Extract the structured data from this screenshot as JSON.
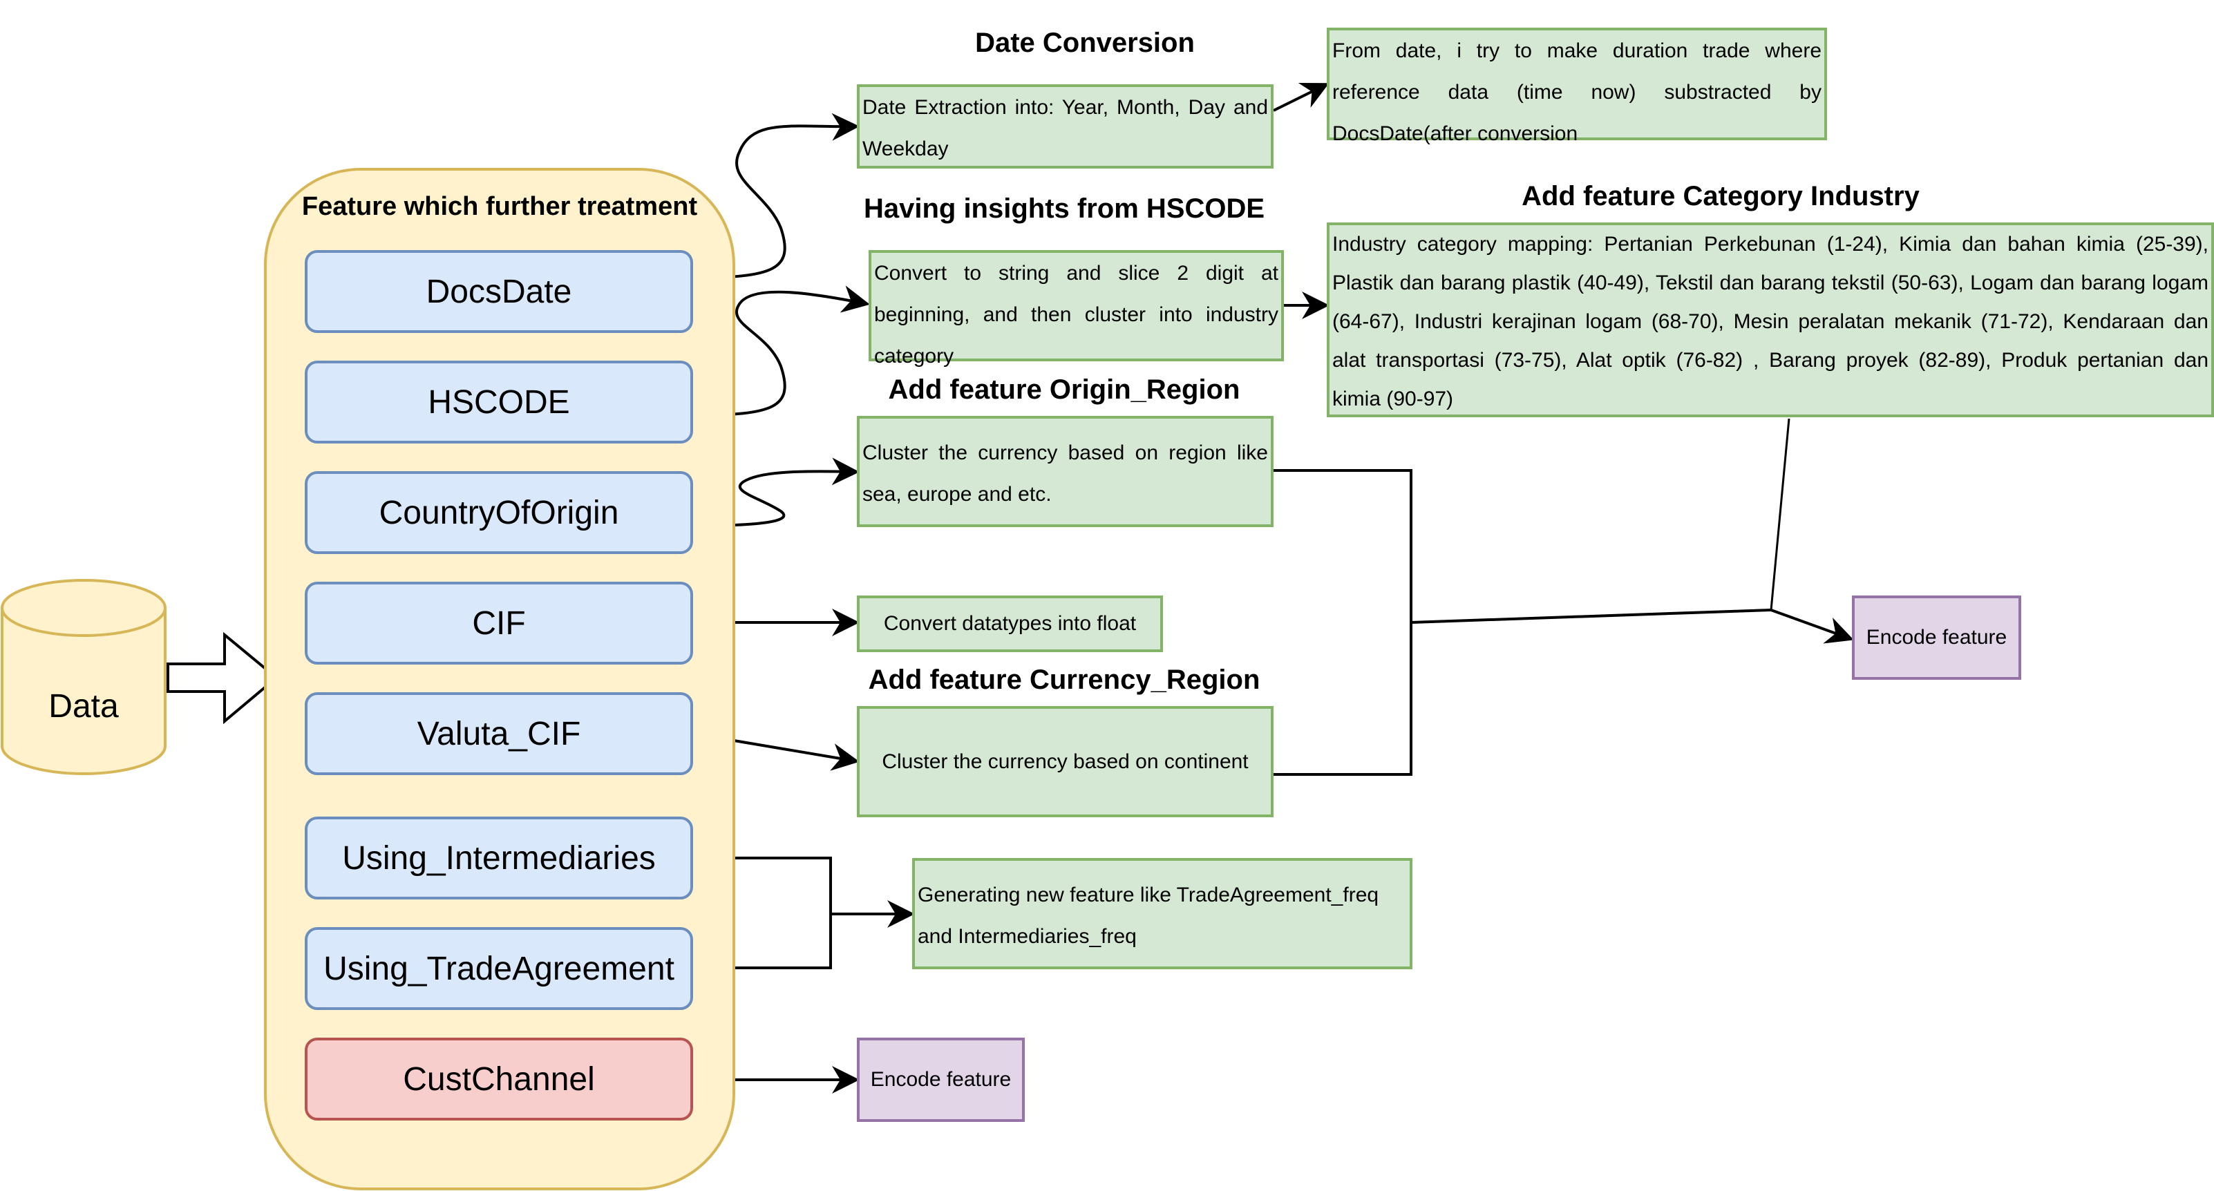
{
  "source": {
    "label": "Data",
    "shape": "cylinder",
    "fill": "#fff2cc",
    "stroke": "#d6b656"
  },
  "container": {
    "title": "Feature which further treatment",
    "fill": "#fff2cc",
    "stroke": "#d6b656"
  },
  "features": [
    {
      "label": "DocsDate",
      "style": "blue"
    },
    {
      "label": "HSCODE",
      "style": "blue"
    },
    {
      "label": "CountryOfOrigin",
      "style": "blue"
    },
    {
      "label": "CIF",
      "style": "blue"
    },
    {
      "label": "Valuta_CIF",
      "style": "blue"
    },
    {
      "label": "Using_Intermediaries",
      "style": "blue"
    },
    {
      "label": "Using_TradeAgreement",
      "style": "blue"
    },
    {
      "label": "CustChannel",
      "style": "red"
    }
  ],
  "section_labels": {
    "date_conversion": "Date Conversion",
    "hscode_insights": "Having insights from HSCODE",
    "category_industry": "Add feature Category Industry",
    "origin_region": "Add feature Origin_Region",
    "currency_region": "Add feature Currency_Region"
  },
  "steps": {
    "date_extraction": "Date Extraction into: Year, Month, Day and Weekday",
    "duration_trade": "From date, i try to make duration trade where reference data (time now) substracted by DocsDate(after conversion",
    "hscode_slice": "Convert to string and slice 2 digit at beginning, and then cluster into industry category",
    "industry_mapping": "Industry category mapping: Pertanian Perkebunan (1-24), Kimia dan bahan kimia (25-39), Plastik dan barang plastik (40-49), Tekstil dan barang tekstil (50-63), Logam dan barang logam (64-67), Industri kerajinan logam (68-70), Mesin peralatan mekanik (71-72), Kendaraan dan alat transportasi (73-75), Alat optik (76-82) , Barang proyek (82-89), Produk pertanian dan kimia (90-97)",
    "origin_cluster": "Cluster the currency based on region like sea, europe and etc.",
    "cif_float": "Convert datatypes into float",
    "currency_cluster": "Cluster the currency based on continent",
    "freq_features": "Generating new feature like TradeAgreement_freq and Intermediaries_freq",
    "encode_main": "Encode feature",
    "encode_channel": "Encode feature"
  },
  "colors": {
    "feature_blue": "#dae8fc",
    "feature_blue_border": "#6c8ebf",
    "feature_red": "#f8cecc",
    "feature_red_border": "#b85450",
    "step_green": "#d5e8d4",
    "step_green_border": "#82b366",
    "encode_purple": "#e1d5e7",
    "encode_purple_border": "#9673a6"
  }
}
